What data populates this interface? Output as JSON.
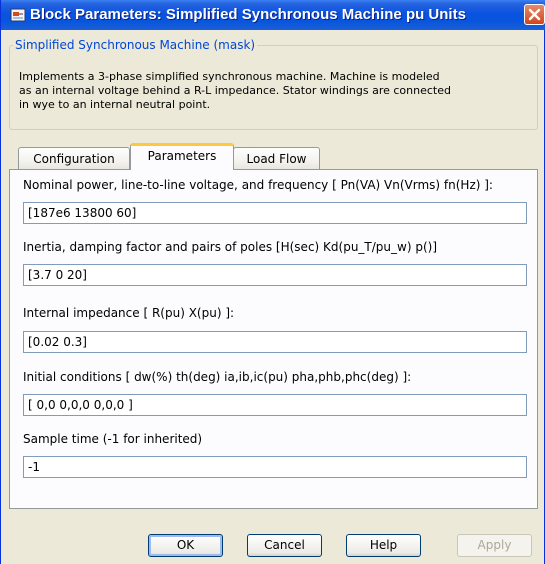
{
  "window": {
    "title": "Block Parameters: Simplified Synchronous Machine pu Units",
    "icon": "simulink-block-icon",
    "close_icon": "close-icon"
  },
  "mask": {
    "legend": "Simplified Synchronous Machine (mask)",
    "description_lines": [
      "Implements a 3-phase simplified synchronous machine. Machine is modeled",
      "as an internal voltage behind a R-L impedance. Stator windings are connected",
      "in wye to an internal neutral point."
    ]
  },
  "tabs": [
    {
      "label": "Configuration",
      "active": false
    },
    {
      "label": "Parameters",
      "active": true
    },
    {
      "label": "Load Flow",
      "active": false
    }
  ],
  "parameters": [
    {
      "label": "Nominal power, line-to-line voltage, and frequency [ Pn(VA) Vn(Vrms) fn(Hz) ]:",
      "value": "[187e6 13800 60]"
    },
    {
      "label": "Inertia, damping factor and pairs of poles [H(sec) Kd(pu_T/pu_w) p()]",
      "value": "[3.7 0 20]"
    },
    {
      "label": "Internal impedance [ R(pu)  X(pu) ]:",
      "value": "[0.02  0.3]"
    },
    {
      "label": "Initial conditions [ dw(%)  th(deg)  ia,ib,ic(pu)  pha,phb,phc(deg) ]:",
      "value": "[ 0,0  0,0,0  0,0,0 ]"
    },
    {
      "label": "Sample time (-1 for inherited)",
      "value": "-1"
    }
  ],
  "buttons": {
    "ok": "OK",
    "cancel": "Cancel",
    "help": "Help",
    "apply": "Apply"
  },
  "colors": {
    "titlebar": "#0a53e0",
    "dialog_bg": "#ece9d8",
    "legend": "#0046d5",
    "active_tab_accent": "#ffc83c"
  }
}
